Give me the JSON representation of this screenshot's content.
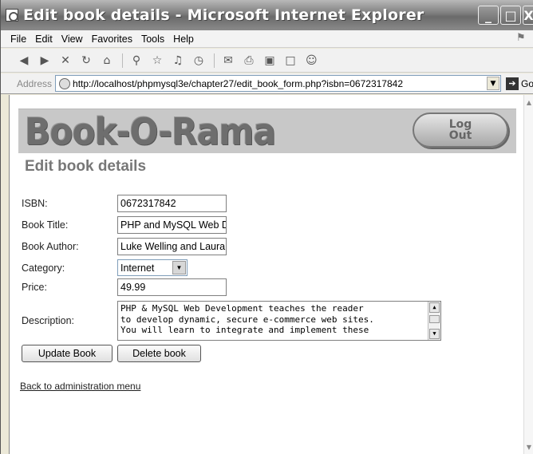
{
  "window": {
    "title": "Edit book details - Microsoft Internet Explorer",
    "minimize_glyph": "_",
    "maximize_glyph": "□",
    "close_glyph": "X"
  },
  "menu": {
    "items": [
      "File",
      "Edit",
      "View",
      "Favorites",
      "Tools",
      "Help"
    ]
  },
  "address": {
    "label": "Address",
    "url": "http://localhost/phpmysql3e/chapter27/edit_book_form.php?isbn=0672317842",
    "go_label": "Go"
  },
  "banner": {
    "brand": "Book-O-Rama",
    "logout_line1": "Log",
    "logout_line2": "Out"
  },
  "page": {
    "title": "Edit book details"
  },
  "form": {
    "isbn_label": "ISBN:",
    "isbn_value": "0672317842",
    "title_label": "Book Title:",
    "title_value": "PHP and MySQL Web De",
    "author_label": "Book Author:",
    "author_value": "Luke Welling and Laura",
    "category_label": "Category:",
    "category_value": "Internet",
    "price_label": "Price:",
    "price_value": "49.99",
    "description_label": "Description:",
    "description_lines": [
      "PHP & MySQL Web Development teaches the reader",
      "to develop dynamic, secure e-commerce web sites.",
      "You will learn to integrate and implement these"
    ],
    "update_button": "Update Book",
    "delete_button": "Delete book"
  },
  "links": {
    "back": "Back to administration menu"
  }
}
